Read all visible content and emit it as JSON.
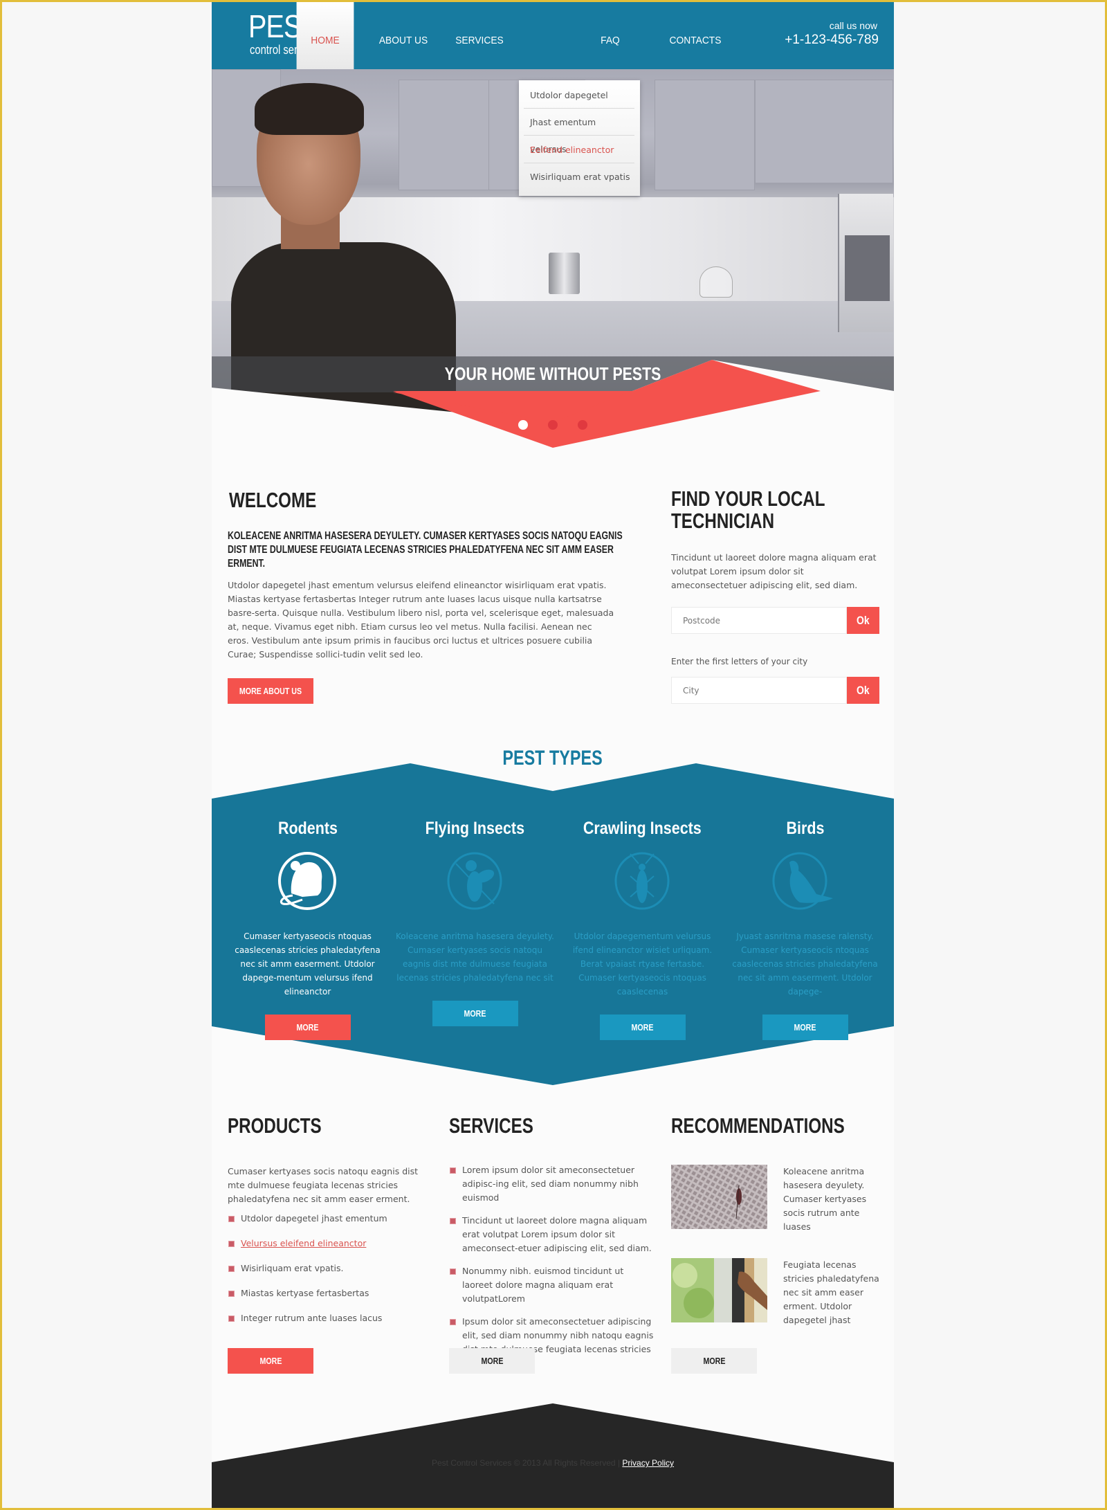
{
  "brand": {
    "logo_main": "PEST",
    "logo_sub": "control services"
  },
  "nav": {
    "items": [
      {
        "label": "HOME",
        "active": true
      },
      {
        "label": "ABOUT US",
        "active": false
      },
      {
        "label": "SERVICES",
        "active": false
      },
      {
        "label": "FAQ",
        "active": false
      },
      {
        "label": "CONTACTS",
        "active": false
      }
    ],
    "submenu": [
      {
        "label": "Utdolor dapegetel",
        "active": false
      },
      {
        "label": "Jhast ementum velursus",
        "active": false
      },
      {
        "label": "Eeifend elineanctor",
        "active": true
      },
      {
        "label": "Wisirliquam erat vpatis",
        "active": false
      }
    ]
  },
  "contact": {
    "call_label": "call us now",
    "phone": "+1-123-456-789"
  },
  "hero": {
    "caption": "YOUR HOME WITHOUT PESTS",
    "slides": 3,
    "active_slide": 1
  },
  "welcome": {
    "title": "WELCOME",
    "lead": "KOLEACENE ANRITMA HASESERA DEYULETY. CUMASER KERTYASES SOCIS NATOQU EAGNIS DIST MTE DULMUESE FEUGIATA LECENAS STRICIES PHALEDATYFENA NEC SIT AMM EASER ERMENT.",
    "text": "Utdolor dapegetel jhast ementum velursus eleifend elineanctor wisirliquam erat vpatis. Miastas kertyase fertasbertas Integer rutrum ante luases lacus uisque nulla kartsatrse basre-serta. Quisque nulla. Vestibulum libero nisl, porta vel, scelerisque eget, malesuada at, neque. Vivamus eget nibh. Etiam cursus leo vel metus. Nulla facilisi. Aenean nec eros. Vestibulum ante ipsum primis in faucibus orci luctus et ultrices posuere cubilia Curae; Suspendisse sollici-tudin velit sed leo.",
    "button": "MORE ABOUT US"
  },
  "technician": {
    "title_line1": "FIND YOUR LOCAL",
    "title_line2": "TECHNICIAN",
    "text": "Tincidunt ut laoreet dolore magna aliquam erat volutpat Lorem ipsum dolor sit ameconsectetuer adipiscing elit, sed diam.",
    "postcode_placeholder": "Postcode",
    "postcode_value": "",
    "city_label": "Enter the first letters of your city",
    "city_placeholder": "City",
    "city_value": "",
    "ok_label": "Ok"
  },
  "pest_types": {
    "title": "PEST TYPES",
    "items": [
      {
        "name": "Rodents",
        "icon": "mouse-icon",
        "active": true,
        "text": "Cumaser kertyaseocis ntoquas caaslecenas stricies phaledatyfena nec sit amm easerment. Utdolor dapege-mentum velursus ifend elineanctor",
        "button": "MORE"
      },
      {
        "name": "Flying Insects",
        "icon": "fly-icon",
        "active": false,
        "text": "Koleacene anritma hasesera deyulety. Cumaser kertyases socis natoqu eagnis dist mte dulmuese feugiata lecenas stricies phaledatyfena nec sit",
        "button": "MORE"
      },
      {
        "name": "Crawling Insects",
        "icon": "cockroach-icon",
        "active": false,
        "text": "Utdolor dapegementum velursus ifend elineanctor wisiet urliquam. Berat vpaiast rtyase fertasbe. Cumaser kertyaseocis ntoquas caaslecenas",
        "button": "MORE"
      },
      {
        "name": "Birds",
        "icon": "bird-icon",
        "active": false,
        "text": "Jyuast asnritma masese ralensty. Cumaser kertyaseocis ntoquas caaslecenas stricies phaledatyfena nec sit amm easerment. Utdolor dapege-",
        "button": "MORE"
      }
    ]
  },
  "products": {
    "title": "PRODUCTS",
    "intro": "Cumaser kertyases socis natoqu eagnis dist mte dulmuese feugiata lecenas stricies phaledatyfena nec sit amm easer erment.",
    "items": [
      {
        "label": "Utdolor dapegetel jhast ementum",
        "link": false
      },
      {
        "label": "Velursus eleifend elineanctor",
        "link": true
      },
      {
        "label": "Wisirliquam erat vpatis.",
        "link": false
      },
      {
        "label": "Miastas kertyase fertasbertas",
        "link": false
      },
      {
        "label": "Integer rutrum ante luases lacus",
        "link": false
      }
    ],
    "button": "MORE"
  },
  "services": {
    "title": "SERVICES",
    "items": [
      "Lorem ipsum dolor sit ameconsectetuer adipisc-ing elit, sed diam nonummy nibh euismod",
      "Tincidunt ut laoreet dolore magna aliquam erat volutpat Lorem ipsum dolor sit ameconsect-etuer adipiscing elit, sed diam.",
      "Nonummy nibh. euismod tincidunt ut laoreet dolore magna aliquam erat volutpatLorem",
      "Ipsum dolor sit ameconsectetuer adipiscing elit, sed diam nonummy nibh natoqu eagnis dist mte dulmuese feugiata lecenas stricies phaledaty."
    ],
    "button": "MORE"
  },
  "recommendations": {
    "title": "RECOMMENDATIONS",
    "items": [
      {
        "image": "mosquito-on-screen-photo",
        "text": "Koleacene anritma hasesera deyulety. Cumaser kertyases socis rutrum ante luases"
      },
      {
        "image": "window-screen-hand-photo",
        "text": "Feugiata lecenas stricies phaledatyfena nec sit amm easer erment. Utdolor dapegetel jhast"
      }
    ],
    "button": "MORE"
  },
  "footer": {
    "copyright": "Pest Control Services © 2013 All Rights Reserved | ",
    "privacy_link": "Privacy Policy"
  },
  "colors": {
    "brand_blue": "#177ba0",
    "accent_red": "#f4524d",
    "button_blue": "#1a98c0",
    "footer_dark": "#262626",
    "frame_yellow": "#e2be3a"
  }
}
